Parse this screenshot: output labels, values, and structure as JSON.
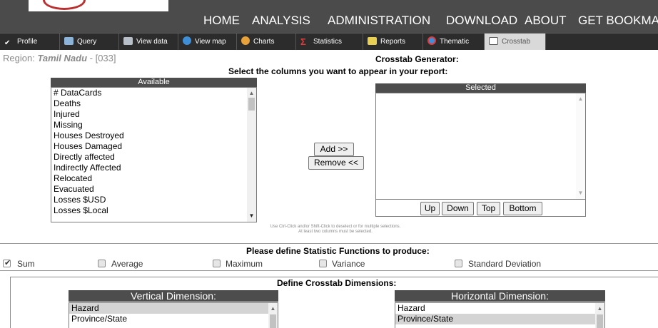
{
  "header": {
    "nav": [
      "HOME",
      "ANALYSIS",
      "ADMINISTRATION",
      "DOWNLOAD",
      "ABOUT",
      "GET BOOKMARK"
    ]
  },
  "tabs": [
    {
      "label": "Profile",
      "icon": "checkmark-icon"
    },
    {
      "label": "Query",
      "icon": "satellite-dish-icon"
    },
    {
      "label": "View data",
      "icon": "table-icon"
    },
    {
      "label": "View map",
      "icon": "globe-icon"
    },
    {
      "label": "Charts",
      "icon": "pie-chart-icon"
    },
    {
      "label": "Statistics",
      "icon": "sigma-icon"
    },
    {
      "label": "Reports",
      "icon": "reports-icon"
    },
    {
      "label": "Thematic",
      "icon": "thematic-globe-icon"
    },
    {
      "label": "Crosstab",
      "icon": "crosstab-grid-icon",
      "active": true
    }
  ],
  "region": {
    "label": "Region:",
    "name": "Tamil Nadu",
    "separator": " - ",
    "code": "[033]"
  },
  "page": {
    "title": "Crosstab Generator:",
    "instruction": "Select the columns you want to appear in your report:",
    "note_line1": "Use Ctrl-Click and/or Shift-Click to deselect or for multiple selections.",
    "note_line2": "At least two columns must be selected."
  },
  "available": {
    "header": "Available",
    "items": [
      "# DataCards",
      "Deaths",
      "Injured",
      "Missing",
      "Houses Destroyed",
      "Houses Damaged",
      "Directly affected",
      "Indirectly Affected",
      "Relocated",
      "Evacuated",
      "Losses $USD",
      "Losses $Local"
    ]
  },
  "selected": {
    "header": "Selected",
    "items": []
  },
  "buttons": {
    "add": "Add >>",
    "remove": "Remove <<",
    "up": "Up",
    "down": "Down",
    "top": "Top",
    "bottom": "Bottom"
  },
  "functions": {
    "heading": "Please define Statistic Functions to produce:",
    "options": [
      {
        "label": "Sum",
        "checked": true
      },
      {
        "label": "Average",
        "checked": false
      },
      {
        "label": "Maximum",
        "checked": false
      },
      {
        "label": "Variance",
        "checked": false
      },
      {
        "label": "Standard Deviation",
        "checked": false
      }
    ]
  },
  "dimensions": {
    "heading": "Define Crosstab Dimensions:",
    "vertical": {
      "header": "Vertical Dimension:",
      "items": [
        "Hazard",
        "Province/State"
      ],
      "selected_index": 0
    },
    "horizontal": {
      "header": "Horizontal Dimension:",
      "items": [
        "Hazard",
        "Province/State"
      ],
      "selected_index": 1
    }
  },
  "colors": {
    "header_bg": "#4b4b4b",
    "tabbar_bg": "#2c2c2c",
    "region_text": "#8a8a8a",
    "list_header_bg": "#4d4d4d"
  }
}
